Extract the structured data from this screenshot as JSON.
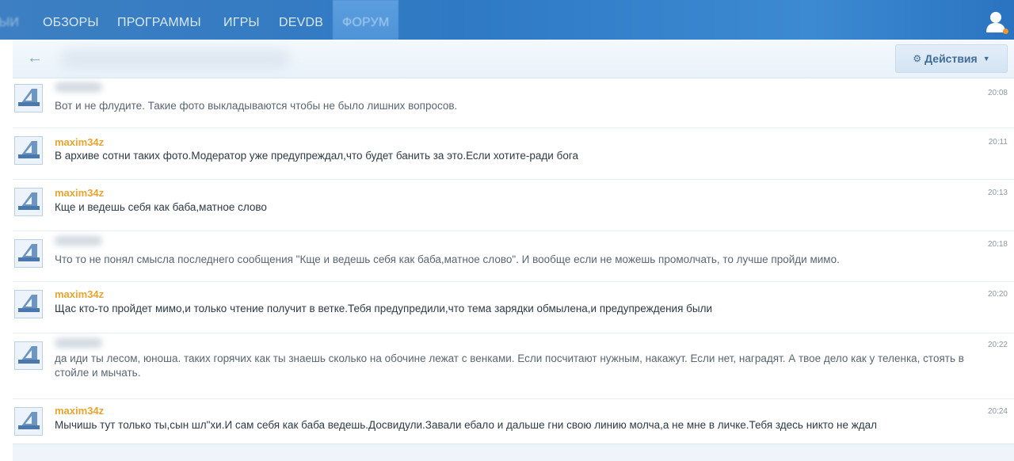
{
  "nav": {
    "items": [
      "ЫИ",
      "ОБЗОРЫ",
      "ПРОГРАММЫ",
      "ИГРЫ",
      "DEVDB",
      "ФОРУМ"
    ],
    "active": "ФОРУМ"
  },
  "toolbar": {
    "actions_label": "Действия"
  },
  "colors": {
    "nav_bg": "#2f79c4",
    "author": "#eca32d",
    "accent": "#3f6c99"
  },
  "messages": [
    {
      "author": "",
      "text": "Вот и не флудите. Такие фото выкладываются чтобы не было лишних вопросов.",
      "time": "20:08"
    },
    {
      "author": "maxim34z",
      "text": "В архиве сотни таких фото.Модератор уже предупреждал,что будет банить за это.Если хотите-ради бога",
      "time": "20:11"
    },
    {
      "author": "maxim34z",
      "text": "Кще и ведешь себя как баба,матное слово",
      "time": "20:13"
    },
    {
      "author": "",
      "text": "Что то не понял смысла последнего сообщения \"Кще и ведешь себя как баба,матное слово\". И вообще если не можешь промолчать, то лучше пройди мимо.",
      "time": "20:18"
    },
    {
      "author": "maxim34z",
      "text": "Щас кто-то пройдет мимо,и только чтение получит в ветке.Тебя предупредили,что тема зарядки обмылена,и предупреждения были",
      "time": "20:20"
    },
    {
      "author": "",
      "text": "да иди ты лесом, юноша. таких горячих как ты знаешь сколько на обочине лежат с венками. Если посчитают нужным, накажут. Если нет, наградят. А твое дело как у теленка, стоять в стойле и мычать.",
      "time": "20:22"
    },
    {
      "author": "maxim34z",
      "text": "Мычишь тут только ты,сын шл\"хи.И сам себя как баба ведешь.Досвидули.Завали ебало и дальше гни свою линию молча,а не мне в личке.Тебя здесь никто не ждал",
      "time": "20:24"
    }
  ]
}
